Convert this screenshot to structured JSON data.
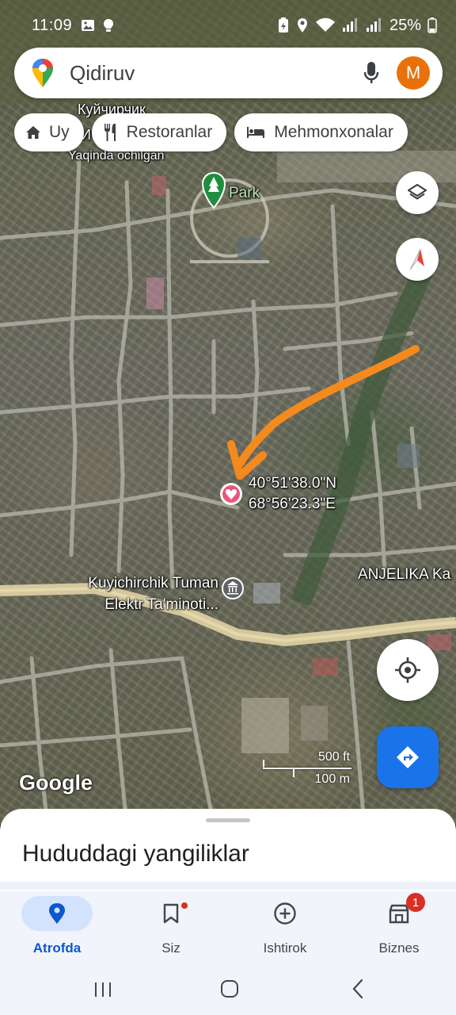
{
  "status_bar": {
    "time": "11:09",
    "battery": "25%"
  },
  "search": {
    "placeholder": "Qidiruv",
    "avatar_letter": "M"
  },
  "chips": [
    {
      "label": "Uy",
      "icon": "home-icon"
    },
    {
      "label": "Restoranlar",
      "icon": "restaurant-icon"
    },
    {
      "label": "Mehmonxonalar",
      "icon": "hotel-icon"
    }
  ],
  "map": {
    "labels": {
      "top_cyrillic": "Куйчирчик",
      "top_cyrillic_2": "И",
      "recent": "Yaqinda ochilgan",
      "park": "Park",
      "office_line1": "Kuyichirchik Tuman",
      "office_line2": "Elektr Ta'minoti...",
      "shop": "ANJELIKA Ka"
    },
    "pin": {
      "lat": "40°51'38.0\"N",
      "lng": "68°56'23.3\"E"
    },
    "scale": {
      "imperial": "500 ft",
      "metric": "100 m"
    },
    "logo": "Google"
  },
  "sheet": {
    "title": "Hududdagi yangiliklar"
  },
  "nav": [
    {
      "label": "Atrofda",
      "icon": "location-pin-icon",
      "active": true
    },
    {
      "label": "Siz",
      "icon": "bookmark-icon",
      "active": false
    },
    {
      "label": "Ishtirok",
      "icon": "add-circle-icon",
      "active": false
    },
    {
      "label": "Biznes",
      "icon": "store-icon",
      "active": false,
      "badge": "1"
    }
  ],
  "colors": {
    "accent": "#1a73e8",
    "annotation_arrow": "#f48a1e",
    "pin": "#e8567c"
  }
}
